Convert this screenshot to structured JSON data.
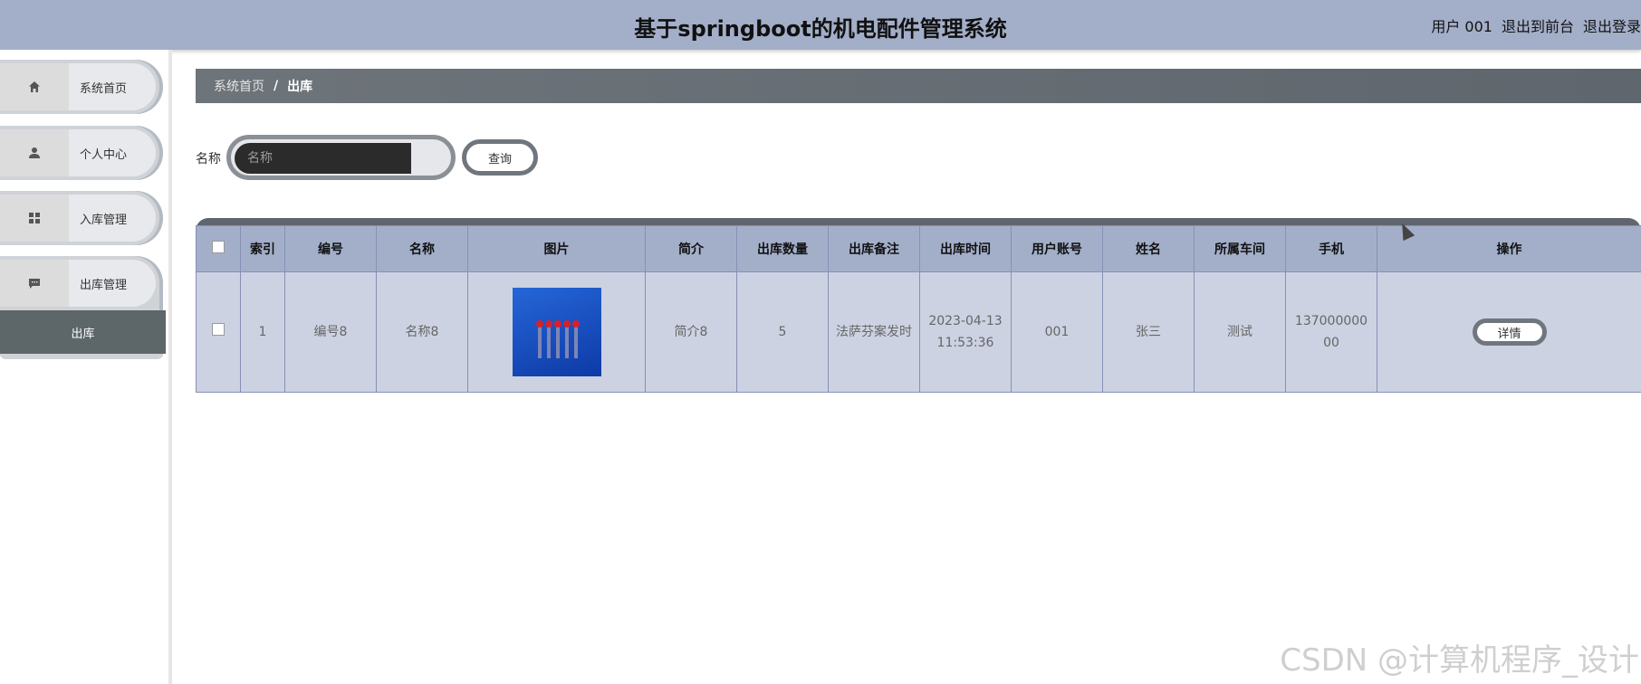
{
  "header": {
    "title": "基于springboot的机电配件管理系统",
    "user": "用户 001",
    "to_front": "退出到前台",
    "logout": "退出登录"
  },
  "sidebar": {
    "items": [
      {
        "label": "系统首页",
        "icon": "home-icon"
      },
      {
        "label": "个人中心",
        "icon": "user-icon"
      },
      {
        "label": "入库管理",
        "icon": "grid-icon"
      },
      {
        "label": "出库管理",
        "icon": "chat-icon"
      }
    ],
    "submenu": {
      "label": "出库"
    }
  },
  "breadcrumb": {
    "home": "系统首页",
    "separator": "/",
    "current": "出库"
  },
  "search": {
    "label": "名称",
    "placeholder": "名称",
    "button": "查询"
  },
  "table": {
    "columns": [
      "",
      "索引",
      "编号",
      "名称",
      "图片",
      "简介",
      "出库数量",
      "出库备注",
      "出库时间",
      "用户账号",
      "姓名",
      "所属车间",
      "手机",
      "操作"
    ],
    "rows": [
      {
        "index": "1",
        "code": "编号8",
        "name": "名称8",
        "intro": "简介8",
        "quantity": "5",
        "remark": "法萨芬案发时",
        "time": "2023-04-13 11:53:36",
        "account": "001",
        "person": "张三",
        "workshop": "测试",
        "phone": "13700000000",
        "action": "详情"
      }
    ]
  },
  "watermark": "CSDN @计算机程序_设计",
  "colors": {
    "header_bg": "#a3afc9",
    "breadcrumb_bg": "#5f666d",
    "table_header_bg": "#a3afc9",
    "table_row_bg": "#ccd2e2"
  }
}
